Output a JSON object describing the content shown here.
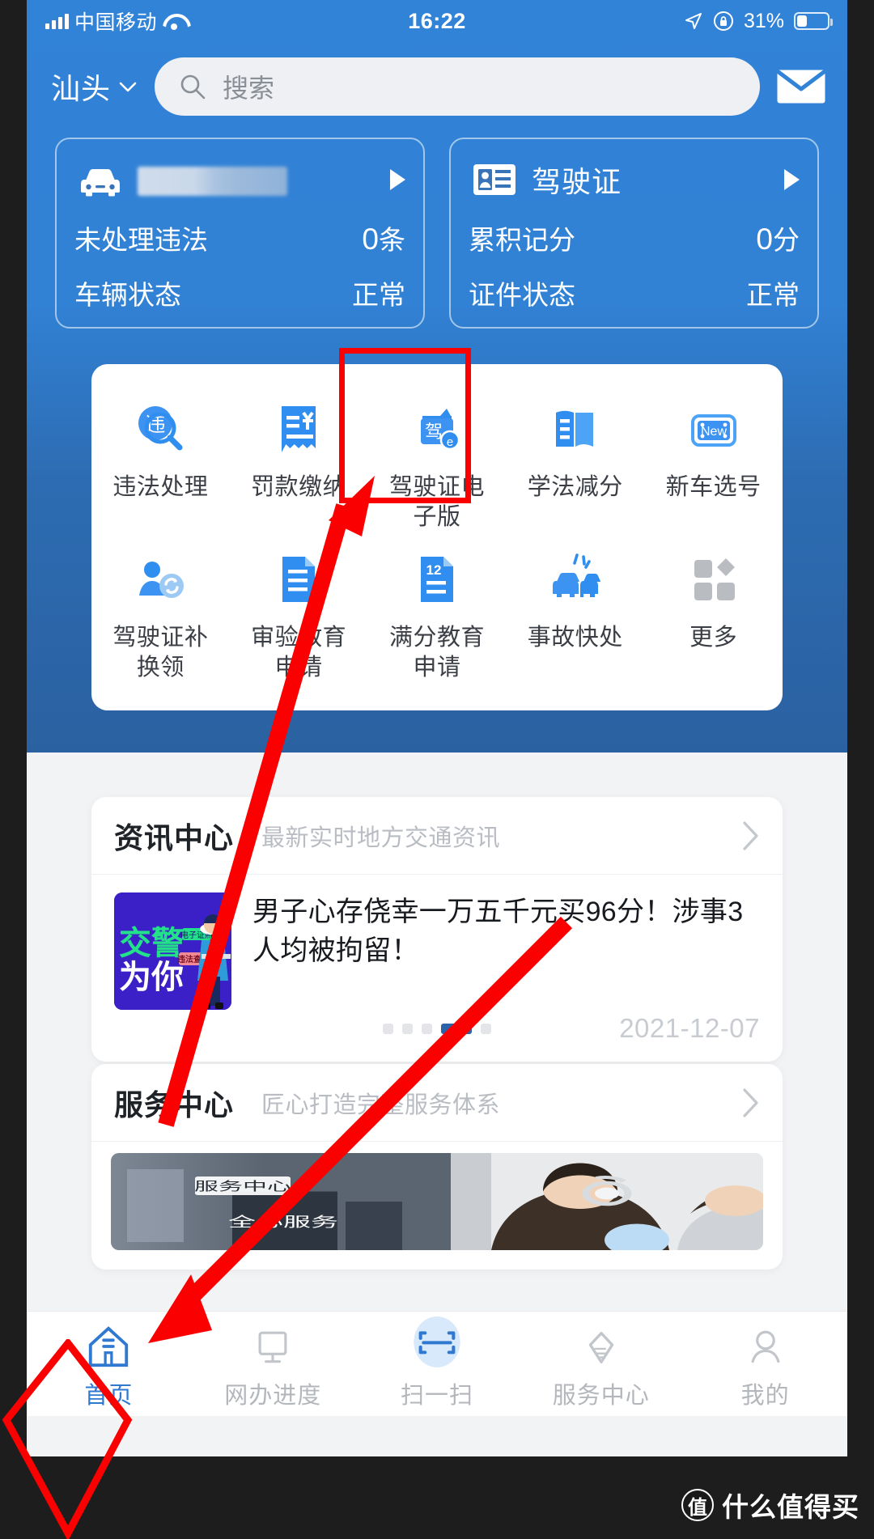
{
  "status_bar": {
    "carrier": "中国移动",
    "time": "16:22",
    "battery_percent": "31%",
    "icons": [
      "signal-bars-icon",
      "wifi-icon",
      "location-arrow-icon",
      "rotation-lock-icon",
      "battery-icon"
    ]
  },
  "header": {
    "city": "汕头",
    "search_placeholder": "搜索",
    "mail_icon": "envelope-icon"
  },
  "cards": [
    {
      "icon": "car-icon",
      "title_redacted": true,
      "rows": [
        {
          "label": "未处理违法",
          "value": "0",
          "unit": "条"
        },
        {
          "label": "车辆状态",
          "value": "正常",
          "unit": ""
        }
      ]
    },
    {
      "icon": "id-card-icon",
      "title": "驾驶证",
      "rows": [
        {
          "label": "累积记分",
          "value": "0",
          "unit": "分"
        },
        {
          "label": "证件状态",
          "value": "正常",
          "unit": ""
        }
      ]
    }
  ],
  "grid": [
    {
      "icon": "violation-search-icon",
      "label": "违法处理"
    },
    {
      "icon": "fine-receipt-icon",
      "label": "罚款缴纳"
    },
    {
      "icon": "e-license-icon",
      "label": "驾驶证电子版",
      "highlighted": true
    },
    {
      "icon": "study-book-icon",
      "label": "学法减分"
    },
    {
      "icon": "new-plate-icon",
      "label": "新车选号"
    },
    {
      "icon": "license-renew-icon",
      "label": "驾驶证补换领"
    },
    {
      "icon": "review-doc-icon",
      "label": "审验教育申请"
    },
    {
      "icon": "full-score-doc-icon",
      "label": "满分教育申请"
    },
    {
      "icon": "accident-car-icon",
      "label": "事故快处"
    },
    {
      "icon": "more-grid-icon",
      "label": "更多"
    }
  ],
  "news_center": {
    "title": "资讯中心",
    "subtitle": "最新实时地方交通资讯",
    "chevron_icon": "chevron-right-icon",
    "article": {
      "title": "男子心存侥幸一万五千元买96分！涉事3人均被拘留！",
      "date": "2021-12-07",
      "thumbnail_text_1": "交警",
      "thumbnail_text_2": "为你",
      "thumbnail_tag_1": "电子证照",
      "thumbnail_tag_2": "违法查询"
    },
    "pager": {
      "count": 5,
      "active_index": 3
    }
  },
  "service_center": {
    "title": "服务中心",
    "subtitle": "匠心打造完整服务体系",
    "chevron_icon": "chevron-right-icon",
    "banner_tag": "服务中心",
    "banner_text": "全心服务"
  },
  "tabbar": [
    {
      "icon": "home-icon",
      "label": "首页",
      "active": true
    },
    {
      "icon": "monitor-icon",
      "label": "网办进度",
      "active": false
    },
    {
      "icon": "scan-icon",
      "label": "扫一扫",
      "active": false
    },
    {
      "icon": "service-heart-icon",
      "label": "服务中心",
      "active": false
    },
    {
      "icon": "person-icon",
      "label": "我的",
      "active": false
    }
  ],
  "annotations": {
    "color": "#fb0000",
    "highlight_box": "驾驶证电子版",
    "highlight_diamond": "首页",
    "arrow_count": 2
  },
  "watermark": {
    "badge": "值",
    "text": "什么值得买"
  },
  "colors": {
    "header_blue": "#3183d8",
    "deep_blue": "#2a5f9e",
    "accent_blue": "#2f7ad0",
    "icon_blue": "#2f8ef0",
    "annotation_red": "#fb0000",
    "page_bg": "#f2f3f5"
  }
}
